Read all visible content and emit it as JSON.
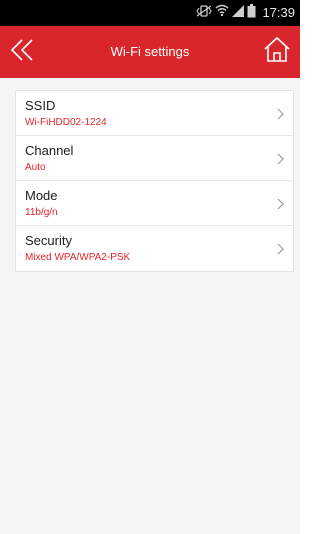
{
  "status_bar": {
    "time": "17:39",
    "icons": [
      "mute-vibrate-icon",
      "wifi-icon",
      "signal-icon",
      "battery-icon"
    ]
  },
  "header": {
    "title": "Wi-Fi settings",
    "back_icon": "double-chevron-left-icon",
    "home_icon": "home-icon"
  },
  "settings": [
    {
      "label": "SSID",
      "value": "Wi-FiHDD02-1224"
    },
    {
      "label": "Channel",
      "value": "Auto"
    },
    {
      "label": "Mode",
      "value": "11b/g/n"
    },
    {
      "label": "Security",
      "value": "Mixed WPA/WPA2-PSK"
    }
  ],
  "colors": {
    "accent": "#d9262c",
    "value_text": "#e5252a",
    "background": "#f5f5f5"
  }
}
